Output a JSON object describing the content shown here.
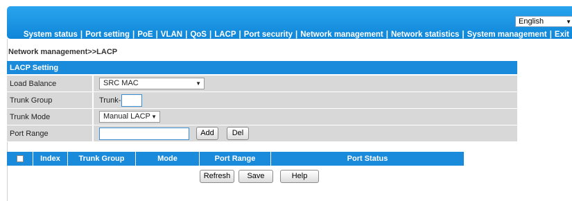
{
  "language": {
    "selected": "English"
  },
  "nav": {
    "items": [
      "System status",
      "Port setting",
      "PoE",
      "VLAN",
      "QoS",
      "LACP",
      "Port security",
      "Network management",
      "Network statistics",
      "System management",
      "Exit"
    ],
    "separator": "|"
  },
  "breadcrumb": "Network management>>LACP",
  "panel": {
    "title": "LACP Setting",
    "load_balance": {
      "label": "Load Balance",
      "value": "SRC MAC"
    },
    "trunk_group": {
      "label": "Trunk Group",
      "prefix": "Trunk-",
      "value": ""
    },
    "trunk_mode": {
      "label": "Trunk Mode",
      "value": "Manual LACP"
    },
    "port_range": {
      "label": "Port Range",
      "value": "",
      "add": "Add",
      "del": "Del"
    }
  },
  "table": {
    "columns": [
      "Index",
      "Trunk Group",
      "Mode",
      "Port Range",
      "Port Status"
    ]
  },
  "actions": {
    "refresh": "Refresh",
    "save": "Save",
    "help": "Help"
  },
  "colors": {
    "header": "#1a8bdb",
    "row_bg": "#d8d8d8"
  }
}
